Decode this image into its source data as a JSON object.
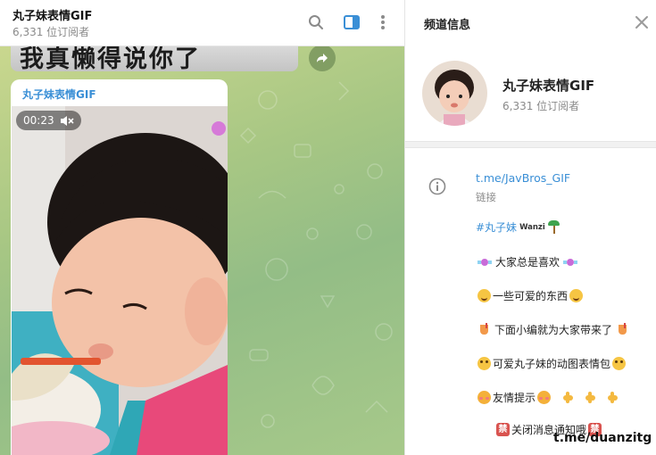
{
  "chat": {
    "title": "丸子妹表情GIF",
    "subscribers": "6,331 位订阅者",
    "previous_message_text": "我真懒得说你了",
    "message": {
      "author": "丸子妹表情GIF",
      "video_duration": "00:23"
    }
  },
  "header_icons": [
    "search-icon",
    "sidebar-toggle-icon",
    "more-vertical-icon"
  ],
  "panel": {
    "title": "频道信息",
    "channel_name": "丸子妹表情GIF",
    "subscribers": "6,331 位订阅者",
    "link": {
      "url": "t.me/JavBros_GIF",
      "label": "链接"
    },
    "description": {
      "hashtag": "#丸子妹",
      "hashtag_suffix": "Wanzi",
      "line1": "大家总是喜欢",
      "line2": "一些可爱的东西",
      "line3": "下面小编就为大家带来了",
      "line4": "可爱丸子妹的动图表情包",
      "line5": "友情提示",
      "line6": "关闭消息通知哦",
      "ban_glyph": "禁"
    }
  },
  "watermark": "t.me/duanzitg",
  "colors": {
    "accent": "#3a8fd6",
    "chat_background": "#a8c784"
  }
}
